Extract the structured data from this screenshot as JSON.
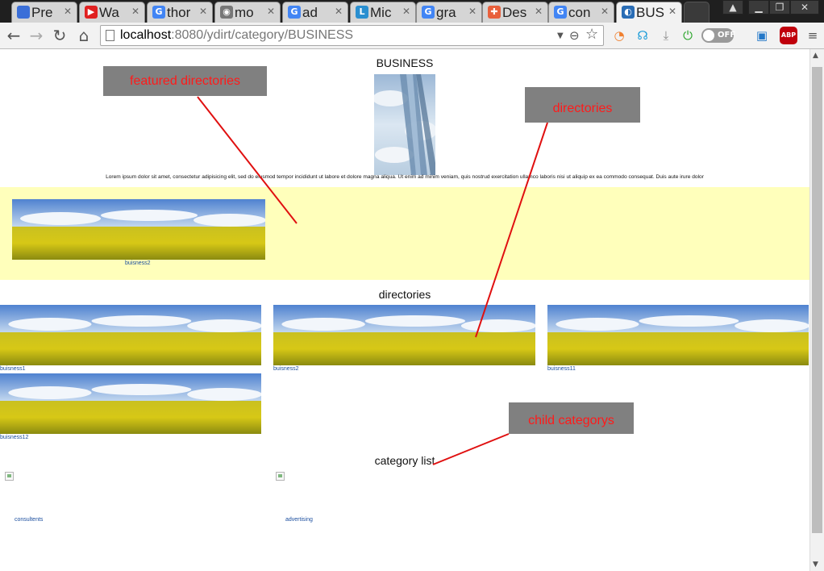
{
  "browser": {
    "tabs": [
      {
        "title": "Pre",
        "favicon_color": "#3b6fd8",
        "favicon_glyph": ""
      },
      {
        "title": "Wa",
        "favicon_color": "#e02020",
        "favicon_glyph": "▶"
      },
      {
        "title": "thor",
        "favicon_color": "#4285f4",
        "favicon_glyph": "G"
      },
      {
        "title": "mo",
        "favicon_color": "#777777",
        "favicon_glyph": "◉"
      },
      {
        "title": "ad",
        "favicon_color": "#4285f4",
        "favicon_glyph": "G"
      },
      {
        "title": "Mic",
        "favicon_color": "#2a8fd0",
        "favicon_glyph": "L"
      },
      {
        "title": "gra",
        "favicon_color": "#4285f4",
        "favicon_glyph": "G"
      },
      {
        "title": "Des",
        "favicon_color": "#e8603c",
        "favicon_glyph": "✚"
      },
      {
        "title": "con",
        "favicon_color": "#4285f4",
        "favicon_glyph": "G"
      },
      {
        "title": "BUS",
        "favicon_color": "#2a6db5",
        "favicon_glyph": "◐"
      }
    ],
    "url_host": "localhost",
    "url_path": ":8080/ydirt/category/BUSINESS",
    "toggle_label": "OFF",
    "abp_label": "ABP"
  },
  "page": {
    "heading": "BUSINESS",
    "description": "Lorem ipsum dolor sit amet, consectetur adipisicing elit, sed do eiusmod tempor incididunt ut labore et dolore magna aliqua. Ut enim ad minim veniam, quis nostrud exercitation ullamco laboris nisi ut aliquip ex ea commodo consequat. Duis aute irure dolor",
    "featured": [
      {
        "name": "buisness2"
      }
    ],
    "directories_title": "directories",
    "directories": [
      {
        "name": "buisness1"
      },
      {
        "name": "buisness2"
      },
      {
        "name": "buisness11"
      },
      {
        "name": "buisness12"
      }
    ],
    "category_list_title": "category list",
    "categories": [
      {
        "name": "consultents"
      },
      {
        "name": "advertising"
      }
    ]
  },
  "annotations": {
    "featured": "featured directories",
    "directories": "directories",
    "child": "child categorys",
    "line_color": "#e01010"
  }
}
